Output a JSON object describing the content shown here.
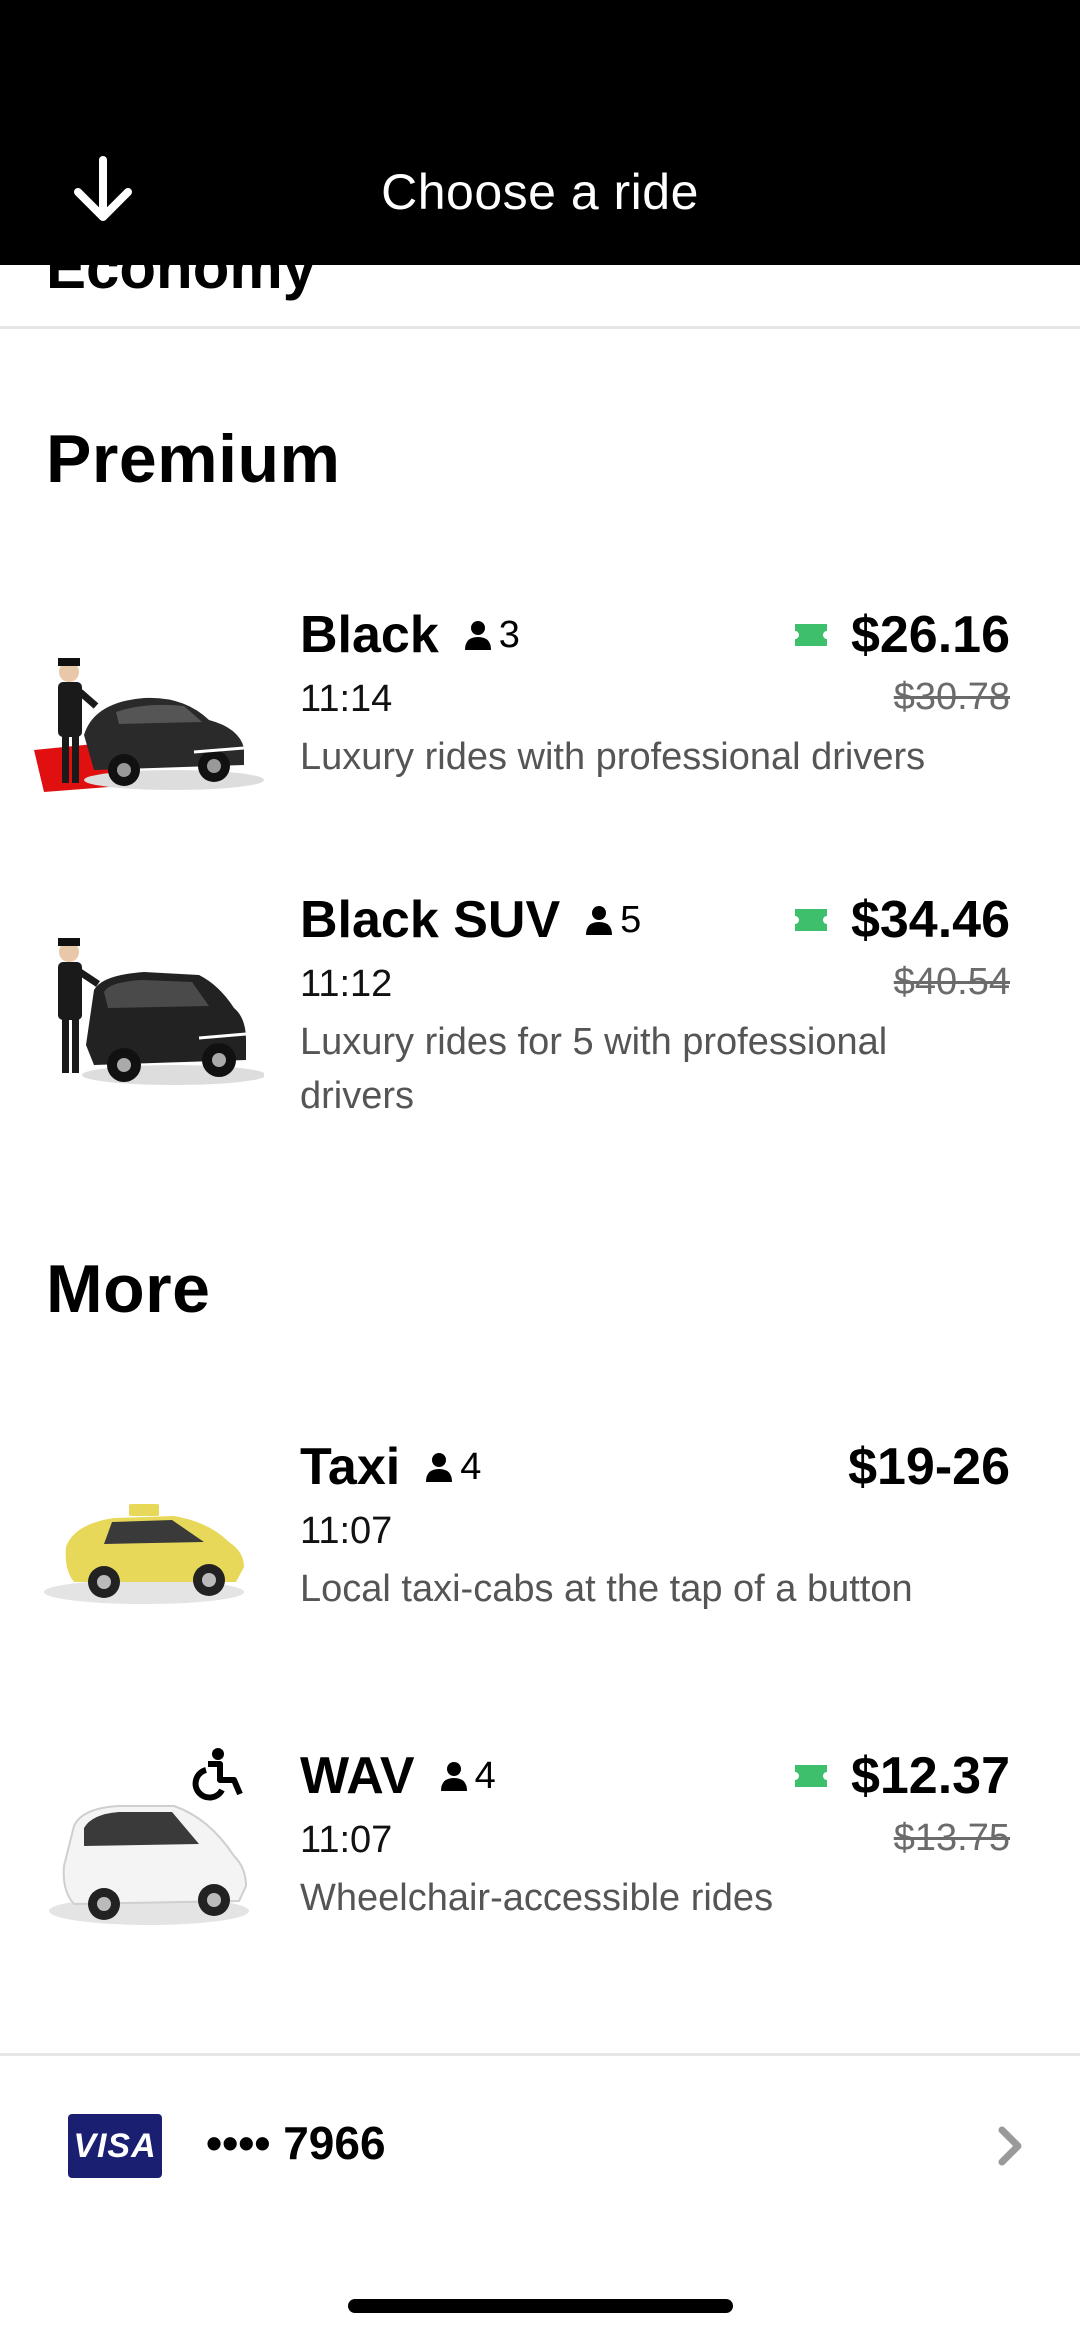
{
  "header": {
    "title": "Choose a ride",
    "back_icon": "arrow-down-icon"
  },
  "peek_section": "Economy",
  "sections": [
    {
      "title": "Premium",
      "rides": [
        {
          "name": "Black",
          "seats": "3",
          "price": "$26.16",
          "original_price": "$30.78",
          "time": "11:14",
          "description": "Luxury rides with professional drivers",
          "promo": true
        },
        {
          "name": "Black SUV",
          "seats": "5",
          "price": "$34.46",
          "original_price": "$40.54",
          "time": "11:12",
          "description": "Luxury rides for 5 with professional drivers",
          "promo": true
        }
      ]
    },
    {
      "title": "More",
      "rides": [
        {
          "name": "Taxi",
          "seats": "4",
          "price": "$19-26",
          "time": "11:07",
          "description": "Local taxi-cabs at the tap of a button",
          "promo": false
        },
        {
          "name": "WAV",
          "seats": "4",
          "price": "$12.37",
          "original_price": "$13.75",
          "time": "11:07",
          "description": "Wheelchair-accessible rides",
          "promo": true
        }
      ]
    }
  ],
  "payment": {
    "brand": "VISA",
    "card": "•••• 7966"
  },
  "colors": {
    "promo_green": "#3dbf6b",
    "header_bg": "#000000",
    "visa_blue": "#1a1f71"
  }
}
